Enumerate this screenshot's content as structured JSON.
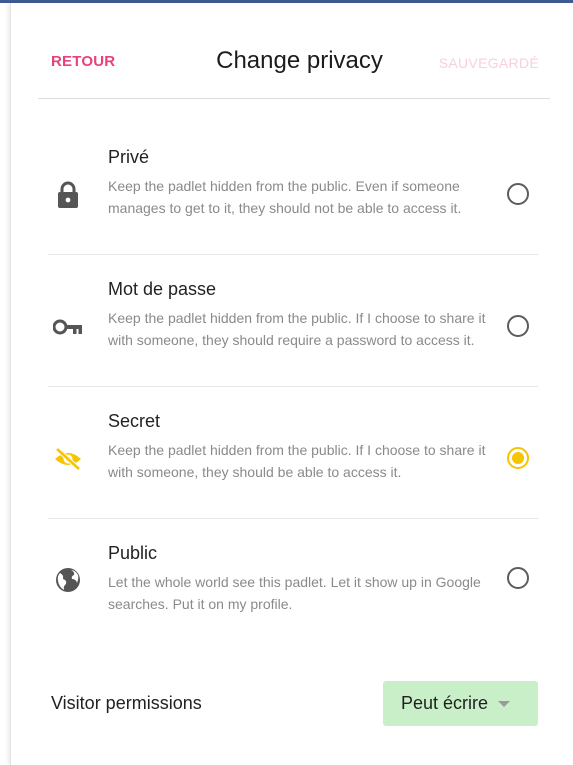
{
  "header": {
    "back_label": "RETOUR",
    "title": "Change privacy",
    "save_label": "SAUVEGARDÉ"
  },
  "options": [
    {
      "title": "Privé",
      "description": "Keep the padlet hidden from the public. Even if someone manages to get to it, they should not be able to access it.",
      "icon": "lock-icon",
      "selected": false
    },
    {
      "title": "Mot de passe",
      "description": "Keep the padlet hidden from the public. If I choose to share it with someone, they should require a password to access it.",
      "icon": "key-icon",
      "selected": false
    },
    {
      "title": "Secret",
      "description": "Keep the padlet hidden from the public. If I choose to share it with someone, they should be able to access it.",
      "icon": "eye-off-icon",
      "selected": true
    },
    {
      "title": "Public",
      "description": "Let the whole world see this padlet. Let it show up in Google searches. Put it on my profile.",
      "icon": "globe-icon",
      "selected": false
    }
  ],
  "permissions": {
    "label": "Visitor permissions",
    "value": "Peut écrire"
  },
  "colors": {
    "accent_pink": "#e8417e",
    "save_disabled": "#f7cfdd",
    "selected_yellow": "#f6c400",
    "permission_bg": "#c9efc9"
  }
}
